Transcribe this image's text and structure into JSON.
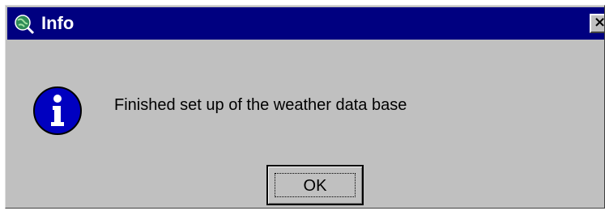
{
  "window": {
    "title": "Info",
    "close_glyph": "×",
    "title_icon": "globe-magnifier-icon",
    "titlebar_color": "#000080",
    "body_color": "#c0c0c0"
  },
  "content": {
    "icon": "info-icon",
    "icon_color": "#0000c0",
    "message": "Finished set up of the weather data base"
  },
  "buttons": {
    "ok_label": "OK"
  }
}
